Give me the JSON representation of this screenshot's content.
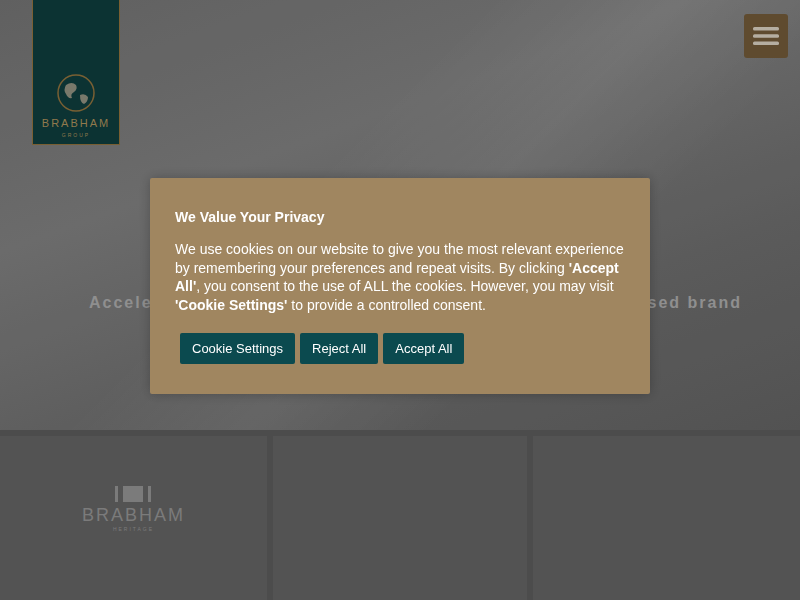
{
  "header": {
    "logo": {
      "name": "BRABHAM",
      "sub": "GROUP"
    }
  },
  "hero": {
    "tagline_fragments": [
      "Accele",
      "sed brand"
    ]
  },
  "cards": [
    {
      "logo": {
        "name": "BRABHAM",
        "sub": "HERITAGE"
      }
    },
    {
      "logo": null
    },
    {
      "logo": null
    }
  ],
  "cookie_banner": {
    "title": "We Value Your Privacy",
    "body": [
      {
        "text": "We use cookies on our website to give you the most relevant experience by remembering your preferences and repeat visits. By clicking ",
        "bold": false
      },
      {
        "text": "'Accept All'",
        "bold": true
      },
      {
        "text": ", you consent to the use of ALL the cookies. However, you may visit ",
        "bold": false
      },
      {
        "text": "'Cookie Settings'",
        "bold": true
      },
      {
        "text": " to provide a controlled consent.",
        "bold": false
      }
    ],
    "buttons": [
      "Cookie Settings",
      "Reject All",
      "Accept All"
    ]
  }
}
